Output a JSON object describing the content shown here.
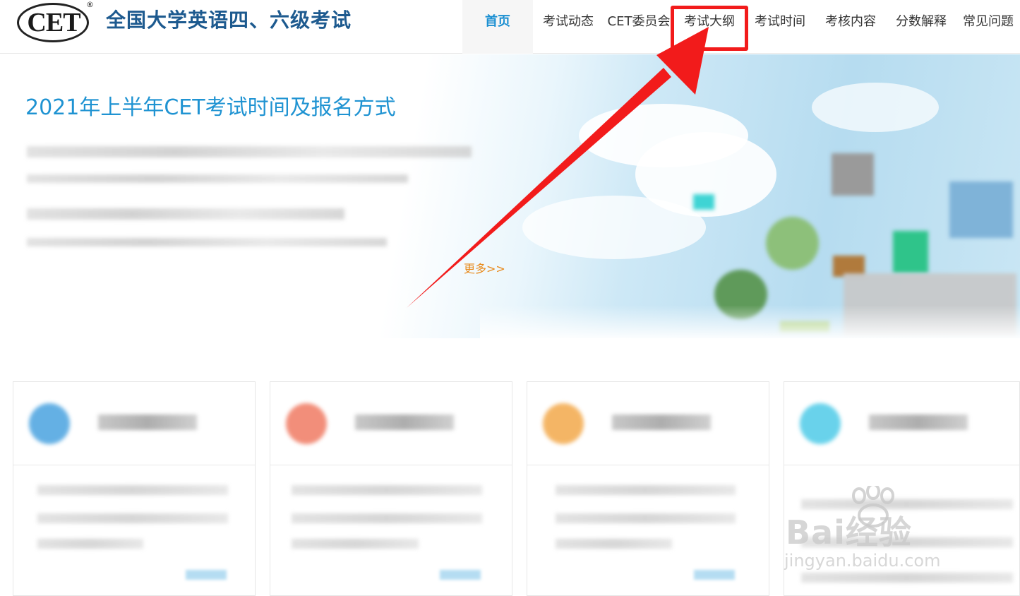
{
  "header": {
    "logo_text": "CET",
    "logo_reg": "®",
    "site_title": "全国大学英语四、六级考试"
  },
  "nav": {
    "items": [
      {
        "label": "首页",
        "active": true
      },
      {
        "label": "考试动态",
        "active": false
      },
      {
        "label": "CET委员会",
        "active": false
      },
      {
        "label": "考试大纲",
        "active": false
      },
      {
        "label": "考试时间",
        "active": false
      },
      {
        "label": "考核内容",
        "active": false
      },
      {
        "label": "分数解释",
        "active": false
      },
      {
        "label": "常见问题",
        "active": false
      }
    ],
    "highlighted_label": "考试大纲"
  },
  "banner": {
    "title": "2021年上半年CET考试时间及报名方式",
    "more_link": "更多>>"
  },
  "annotation": {
    "color": "#f21b1b"
  },
  "cards": {
    "count": 4,
    "icon_colors": [
      "#4aa3e0",
      "#f07b63",
      "#f3a94b",
      "#4fcbe8"
    ]
  },
  "watermark": {
    "brand": "Bai经验",
    "site": "jingyan.baidu.com"
  },
  "colors": {
    "title_blue": "#1d5a8f",
    "nav_active": "#1a8fd1",
    "banner_title": "#1f93d2",
    "more_orange": "#e88a1c"
  }
}
